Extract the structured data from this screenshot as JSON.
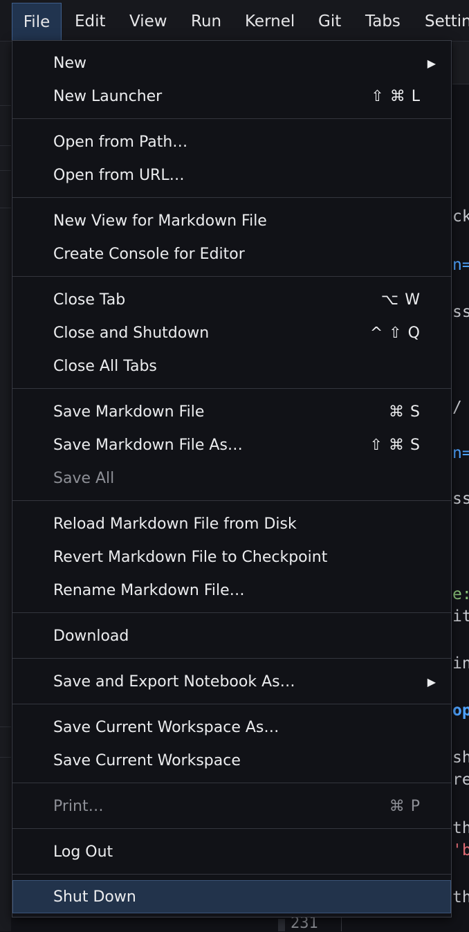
{
  "menubar": {
    "items": [
      "File",
      "Edit",
      "View",
      "Run",
      "Kernel",
      "Git",
      "Tabs",
      "Settin"
    ]
  },
  "file_menu": {
    "new": {
      "label": "New"
    },
    "new_launcher": {
      "label": "New Launcher",
      "shortcut": "⇧ ⌘ L"
    },
    "open_from_path": {
      "label": "Open from Path…"
    },
    "open_from_url": {
      "label": "Open from URL…"
    },
    "new_view_markdown": {
      "label": "New View for Markdown File"
    },
    "create_console": {
      "label": "Create Console for Editor"
    },
    "close_tab": {
      "label": "Close Tab",
      "shortcut": "⌥ W"
    },
    "close_and_shutdown": {
      "label": "Close and Shutdown",
      "shortcut": "^ ⇧ Q"
    },
    "close_all_tabs": {
      "label": "Close All Tabs"
    },
    "save_markdown": {
      "label": "Save Markdown File",
      "shortcut": "⌘ S"
    },
    "save_markdown_as": {
      "label": "Save Markdown File As…",
      "shortcut": "⇧ ⌘ S"
    },
    "save_all": {
      "label": "Save All"
    },
    "reload_markdown": {
      "label": "Reload Markdown File from Disk"
    },
    "revert_markdown": {
      "label": "Revert Markdown File to Checkpoint"
    },
    "rename_markdown": {
      "label": "Rename Markdown File…"
    },
    "download": {
      "label": "Download"
    },
    "save_export_notebook": {
      "label": "Save and Export Notebook As…"
    },
    "save_workspace_as": {
      "label": "Save Current Workspace As…"
    },
    "save_workspace": {
      "label": "Save Current Workspace"
    },
    "print": {
      "label": "Print…",
      "shortcut": "⌘ P"
    },
    "log_out": {
      "label": "Log Out"
    },
    "shut_down": {
      "label": "Shut Down"
    }
  },
  "editor_peek": {
    "lines": [
      "ck",
      "n=",
      "ss",
      "/ l",
      "n=",
      "ss",
      "e:",
      "ith",
      "int",
      "op",
      "sho",
      "re",
      "th",
      "'be",
      "th"
    ],
    "line_number": "231"
  }
}
